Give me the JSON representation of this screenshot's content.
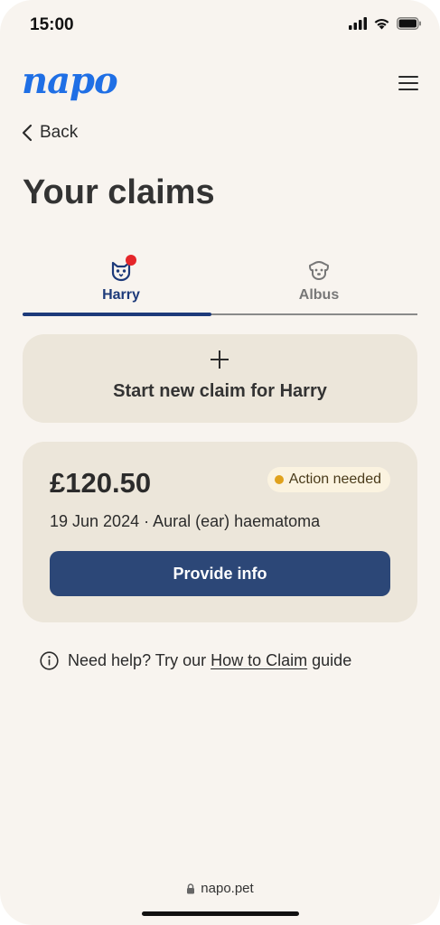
{
  "status_bar": {
    "time": "15:00",
    "icons": [
      "signal-icon",
      "wifi-icon",
      "battery-icon"
    ]
  },
  "header": {
    "logo_text": "napo",
    "logo_color": "#1f6fe5",
    "menu_icon": "hamburger-menu-icon"
  },
  "nav": {
    "back_label": "Back"
  },
  "page": {
    "title": "Your claims"
  },
  "tabs": [
    {
      "label": "Harry",
      "icon": "cat-face-icon",
      "active": true,
      "has_notification": true
    },
    {
      "label": "Albus",
      "icon": "dog-face-icon",
      "active": false,
      "has_notification": false
    }
  ],
  "new_claim": {
    "label": "Start new claim for Harry",
    "icon": "plus-icon"
  },
  "claims": [
    {
      "amount": "£120.50",
      "status": "Action needed",
      "status_color": "#e0a21d",
      "details": "19 Jun 2024 · Aural (ear) haematoma",
      "action_label": "Provide info"
    }
  ],
  "help": {
    "prefix": "Need help? Try our",
    "link_text": "How to Claim",
    "suffix": "guide",
    "icon": "info-icon"
  },
  "browser": {
    "url": "napo.pet",
    "icon": "lock-icon"
  },
  "colors": {
    "background": "#f8f4ef",
    "card": "#ece6da",
    "primary_button": "#2c4777",
    "active_tab": "#1d3a7a",
    "notification": "#e5262a"
  }
}
